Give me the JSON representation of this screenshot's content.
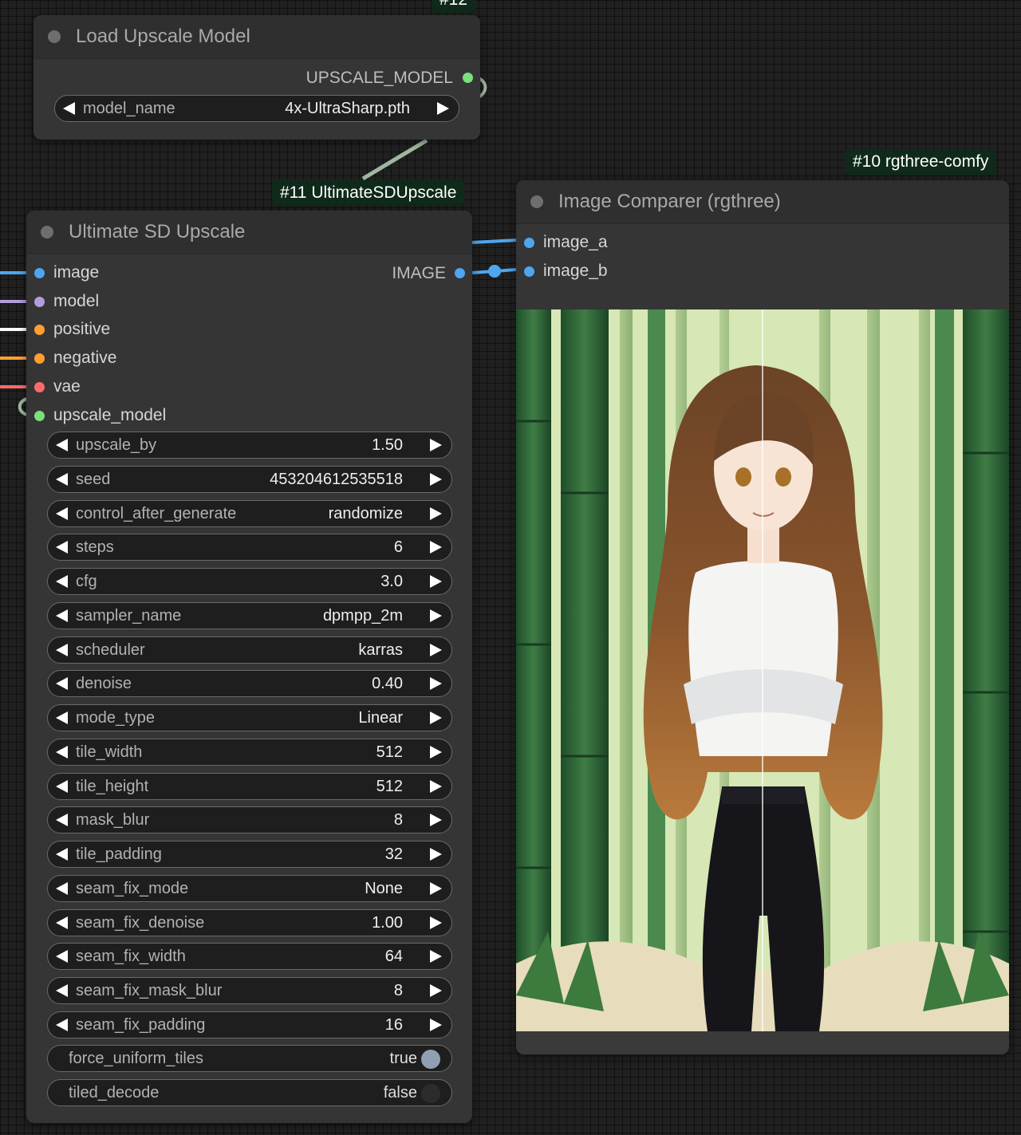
{
  "colors": {
    "image": "#4ea6ee",
    "model": "#b39ddb",
    "positive": "#ffa031",
    "negative": "#ffa031",
    "vae": "#ff6b6b",
    "upscale_model": "#7be07b"
  },
  "upscale_loader": {
    "partial_badge": "#12",
    "title": "Load Upscale Model",
    "output": "UPSCALE_MODEL",
    "widget": {
      "name": "model_name",
      "value": "4x-UltraSharp.pth"
    }
  },
  "usd_node": {
    "badge": "#11 UltimateSDUpscale",
    "title": "Ultimate SD Upscale",
    "inputs": [
      "image",
      "model",
      "positive",
      "negative",
      "vae",
      "upscale_model"
    ],
    "output": "IMAGE",
    "widgets": [
      {
        "name": "upscale_by",
        "value": "1.50"
      },
      {
        "name": "seed",
        "value": "453204612535518"
      },
      {
        "name": "control_after_generate",
        "value": "randomize"
      },
      {
        "name": "steps",
        "value": "6"
      },
      {
        "name": "cfg",
        "value": "3.0"
      },
      {
        "name": "sampler_name",
        "value": "dpmpp_2m"
      },
      {
        "name": "scheduler",
        "value": "karras"
      },
      {
        "name": "denoise",
        "value": "0.40"
      },
      {
        "name": "mode_type",
        "value": "Linear"
      },
      {
        "name": "tile_width",
        "value": "512"
      },
      {
        "name": "tile_height",
        "value": "512"
      },
      {
        "name": "mask_blur",
        "value": "8"
      },
      {
        "name": "tile_padding",
        "value": "32"
      },
      {
        "name": "seam_fix_mode",
        "value": "None"
      },
      {
        "name": "seam_fix_denoise",
        "value": "1.00"
      },
      {
        "name": "seam_fix_width",
        "value": "64"
      },
      {
        "name": "seam_fix_mask_blur",
        "value": "8"
      },
      {
        "name": "seam_fix_padding",
        "value": "16"
      }
    ],
    "toggles": [
      {
        "name": "force_uniform_tiles",
        "value": "true"
      },
      {
        "name": "tiled_decode",
        "value": "false"
      }
    ]
  },
  "comparer_node": {
    "badge": "#10 rgthree-comfy",
    "title": "Image Comparer (rgthree)",
    "inputs": [
      "image_a",
      "image_b"
    ]
  }
}
